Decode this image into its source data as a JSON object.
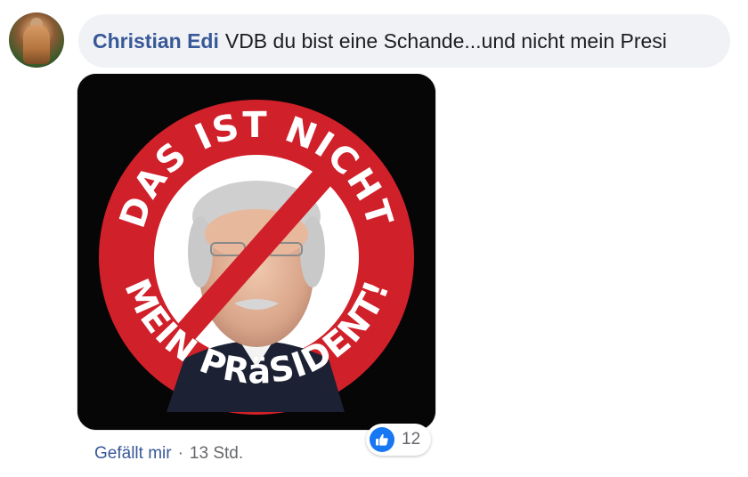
{
  "comment": {
    "author": "Christian Edi",
    "text": "VDB du bist eine Schande...und nicht mein Presi"
  },
  "image": {
    "text_top": "DAS IST NICHT",
    "text_bottom": "MEIN PRäSIDENT!"
  },
  "actions": {
    "like_label": "Gefällt mir",
    "separator": "·",
    "timestamp": "13 Std."
  },
  "reactions": {
    "icon": "thumbs-up-icon",
    "count": "12"
  },
  "colors": {
    "author": "#385898",
    "bubble": "#f0f2f5",
    "sign_red": "#d0202a",
    "like_blue": "#1877f2"
  }
}
